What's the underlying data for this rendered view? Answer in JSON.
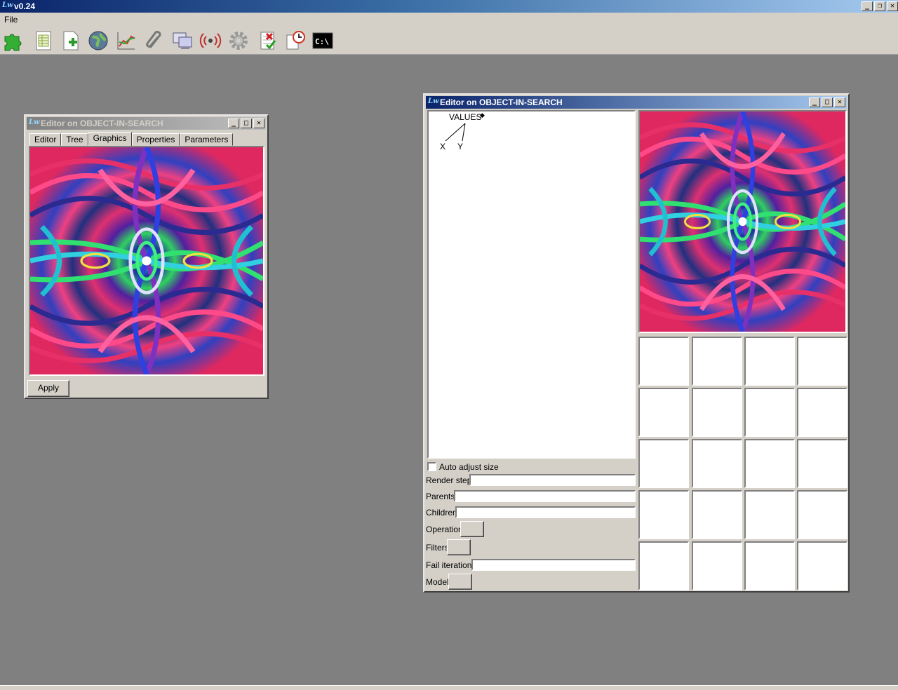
{
  "app": {
    "title": "v0.24",
    "logo": "Lw",
    "menu": [
      "File"
    ]
  },
  "toolbar": {
    "icons": [
      "puzzle-icon",
      "spreadsheet-icon",
      "new-document-icon",
      "globe-icon",
      "chart-icon",
      "paperclip-icon",
      "monitors-icon",
      "broadcast-icon",
      "gear-icon",
      "task-check-icon",
      "clock-document-icon",
      "console-icon"
    ]
  },
  "left_window": {
    "title": "Editor on OBJECT-IN-SEARCH",
    "tabs": [
      "Editor",
      "Tree",
      "Graphics",
      "Properties",
      "Parameters"
    ],
    "selected_tab": "Graphics",
    "apply_label": "Apply"
  },
  "right_window": {
    "title": "Editor on OBJECT-IN-SEARCH",
    "tree": {
      "root": "VALUES",
      "children": [
        "X",
        "Y"
      ]
    },
    "auto_adjust_label": "Auto adjust size",
    "auto_adjust_checked": false,
    "fields": {
      "render_step": "Render step",
      "parents": "Parents",
      "children": "Children",
      "operation": "Operation",
      "filters": "Filters",
      "fail_iterations": "Fail iterations",
      "model": "Model"
    }
  },
  "colors": {
    "desktop": "#808080",
    "chrome": "#d4d0c8",
    "active_title_start": "#0a246a",
    "active_title_end": "#a6caf0"
  }
}
